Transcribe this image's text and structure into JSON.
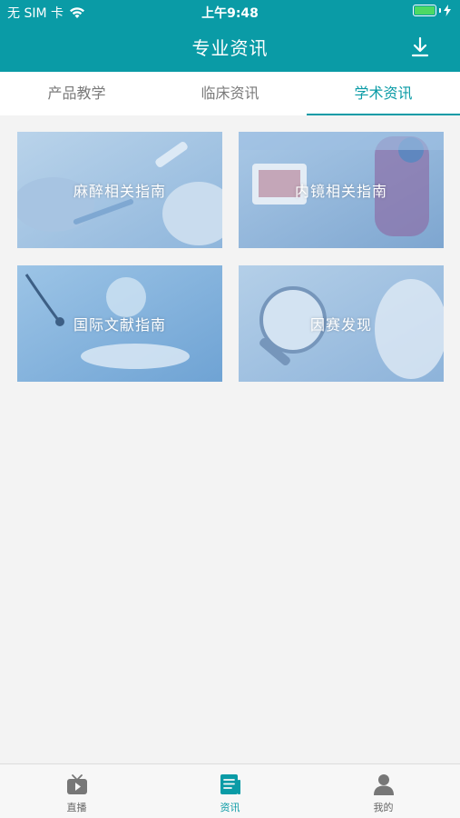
{
  "status": {
    "carrier": "无 SIM 卡",
    "time": "上午9:48"
  },
  "header": {
    "title": "专业资讯",
    "download_icon": "download-icon"
  },
  "tabs": [
    {
      "label": "产品教学",
      "active": false
    },
    {
      "label": "临床资讯",
      "active": false
    },
    {
      "label": "学术资讯",
      "active": true
    }
  ],
  "cards": [
    {
      "label": "麻醉相关指南"
    },
    {
      "label": "内镜相关指南"
    },
    {
      "label": "国际文献指南"
    },
    {
      "label": "因赛发现"
    }
  ],
  "tabbar": [
    {
      "label": "直播",
      "icon": "tv-play-icon",
      "active": false
    },
    {
      "label": "资讯",
      "icon": "news-icon",
      "active": true
    },
    {
      "label": "我的",
      "icon": "person-icon",
      "active": false
    }
  ],
  "colors": {
    "accent": "#0a9ba6",
    "background": "#f3f3f3",
    "battery": "#4cd964"
  }
}
